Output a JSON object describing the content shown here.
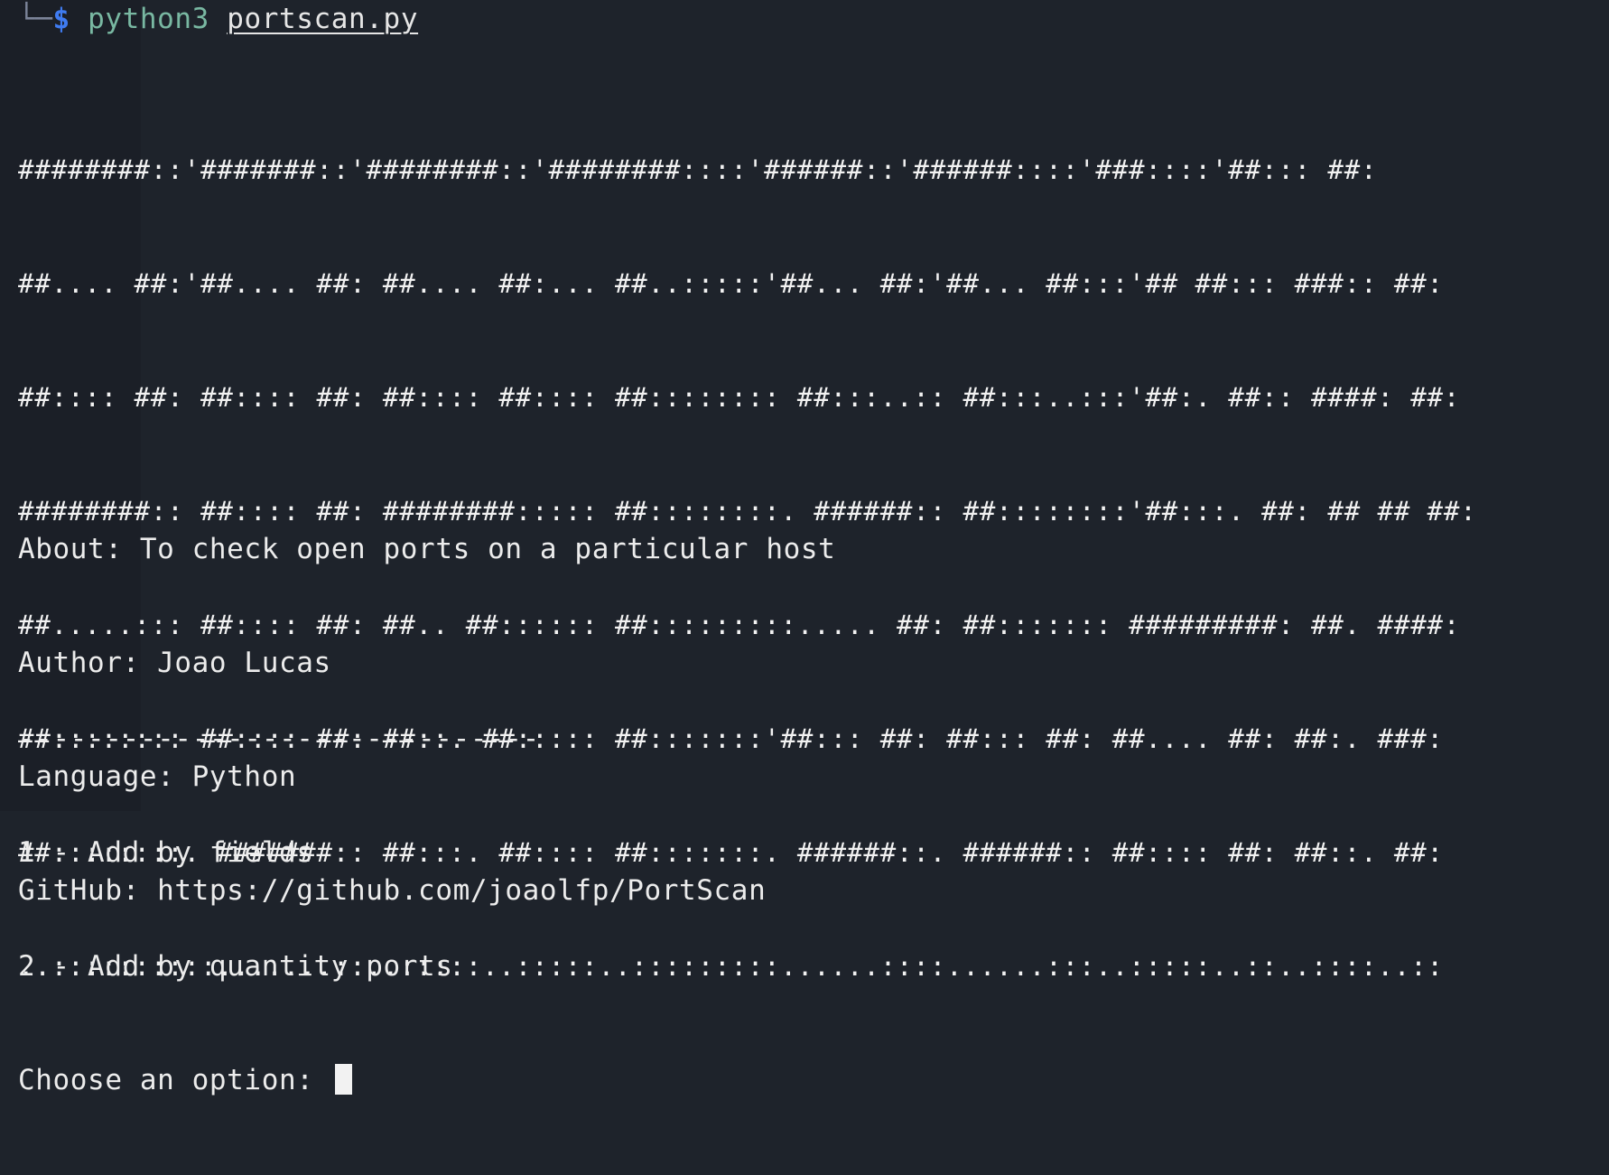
{
  "prompt": {
    "corner": "└─",
    "symbol": "$",
    "command": "python3",
    "argument": "portscan.py"
  },
  "banner": [
    "########::'#######::'########::'########::::'######::'######::::'###::::'##::: ##:",
    "##.... ##:'##.... ##: ##.... ##:... ##..:::::'##... ##:'##... ##:::'## ##::: ###:: ##:",
    "##:::: ##: ##:::: ##: ##:::: ##:::: ##:::::::: ##:::..:: ##:::..:::'##:. ##:: ####: ##:",
    "########:: ##:::: ##: ########::::: ##::::::::. ######:: ##::::::::'##:::. ##: ## ## ##:",
    "##.....::: ##:::: ##: ##.. ##:::::: ##:::::::::..... ##: ##::::::: #########: ##. ####:",
    "##:::::::: ##:::: ##: ##::. ##::::: ##:::::::'##::: ##: ##::: ##: ##.... ##: ##:. ###:",
    "##::::::::. #######:: ##:::. ##:::: ##:::::::. ######::. ######:: ##:::: ##: ##::. ##:",
    "..::::::::::.......::..:::::..:::::..:::::::::......::::......:::..:::::..::..::::..::"
  ],
  "info": {
    "about": "About: To check open ports on a particular host",
    "author": "Author: Joao Lucas",
    "language": "Language: Python",
    "github": "GitHub: https://github.com/joaolfp/PortScan"
  },
  "menu": {
    "separator": "------------------------------",
    "option1": "1 - Add by fields",
    "option2": "2 - Add by quantity ports",
    "choose_prompt": "Choose an option: ",
    "input_value": ""
  }
}
